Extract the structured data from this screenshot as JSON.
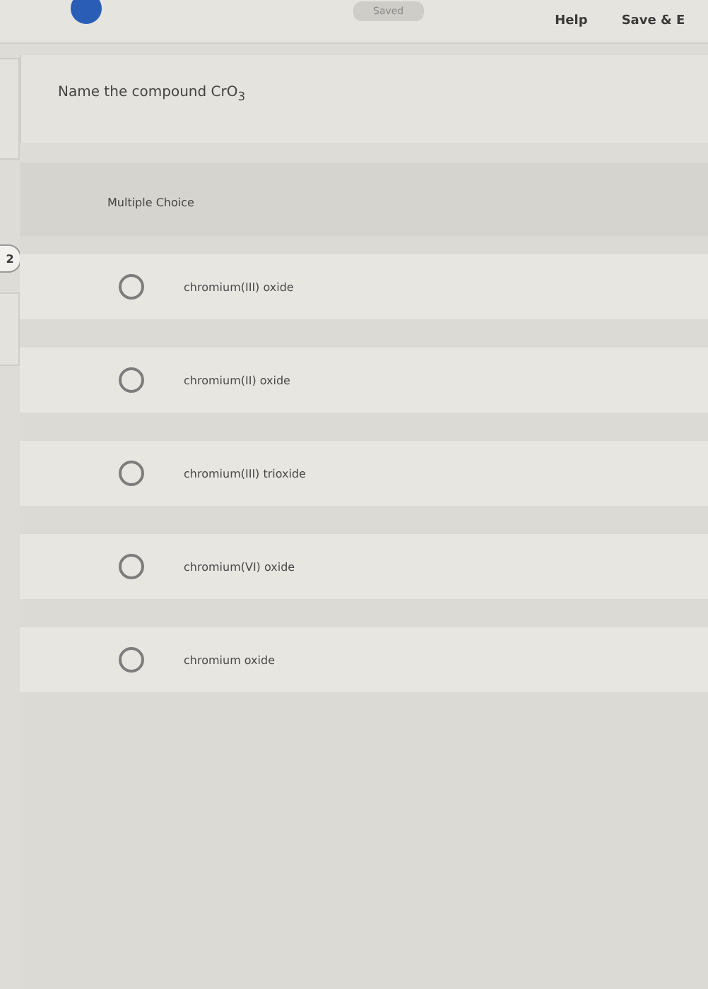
{
  "header": {
    "status": "Saved",
    "links": [
      "Help",
      "Save & E"
    ]
  },
  "question": {
    "number": "2",
    "prompt": "Name the compound CrO$_{3}$"
  },
  "answer": {
    "type_label": "Multiple Choice",
    "options": [
      {
        "label": "chromium(III) oxide",
        "selected": false
      },
      {
        "label": "chromium(II) oxide",
        "selected": false
      },
      {
        "label": "chromium(III) trioxide",
        "selected": false
      },
      {
        "label": "chromium(VI) oxide",
        "selected": false
      },
      {
        "label": "chromium oxide",
        "selected": false
      }
    ]
  }
}
